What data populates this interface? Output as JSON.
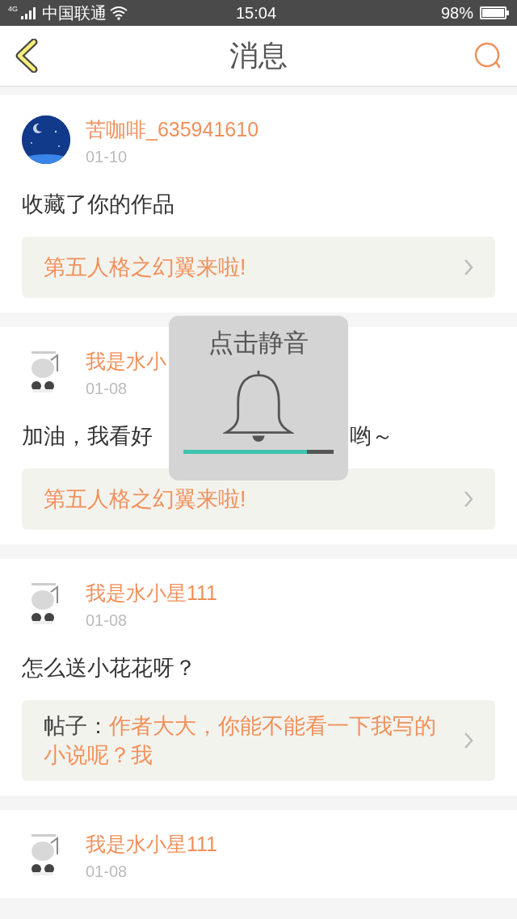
{
  "status_bar": {
    "network": "4G",
    "carrier": "中国联通",
    "time": "15:04",
    "battery": "98%"
  },
  "header": {
    "title": "消息"
  },
  "messages": [
    {
      "user": "苦咖啡_635941610",
      "date": "01-10",
      "text": "收藏了你的作品",
      "attachment": {
        "text": "第五人格之幻翼来啦!"
      }
    },
    {
      "kind": "sticker",
      "user": "我是水小",
      "date": "01-08",
      "text": "加油，我看好",
      "text_after_popup": "哟～",
      "attachment": {
        "text": "第五人格之幻翼来啦!"
      }
    },
    {
      "kind": "sticker",
      "user": "我是水小星111",
      "date": "01-08",
      "text": "怎么送小花花呀？",
      "attachment": {
        "prefix": "帖子：",
        "text": "作者大大，你能不能看一下我写的小说呢？我"
      }
    },
    {
      "kind": "sticker",
      "user": "我是水小星111",
      "date": "01-08"
    }
  ],
  "volume_popup": {
    "title": "点击静音",
    "level": 0.82
  }
}
